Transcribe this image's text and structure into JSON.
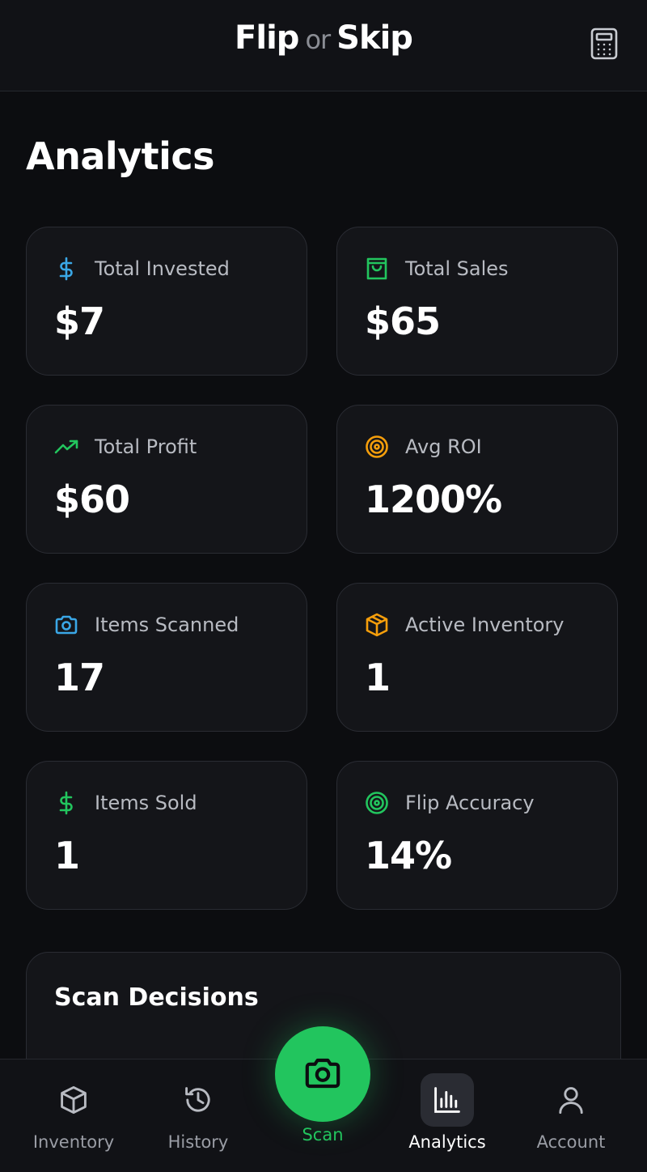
{
  "header": {
    "logo": {
      "word1": "Flip",
      "word2": "or",
      "word3": "Skip"
    },
    "calculator_icon": "calculator-icon"
  },
  "page": {
    "title": "Analytics"
  },
  "stats": [
    {
      "label": "Total Invested",
      "value": "$7",
      "icon": "dollar-icon",
      "color": "#3aa7e6"
    },
    {
      "label": "Total Sales",
      "value": "$65",
      "icon": "shopping-bag-icon",
      "color": "#22c55e"
    },
    {
      "label": "Total Profit",
      "value": "$60",
      "icon": "trending-up-icon",
      "color": "#22c55e"
    },
    {
      "label": "Avg ROI",
      "value": "1200%",
      "icon": "target-icon",
      "color": "#f59e0b"
    },
    {
      "label": "Items Scanned",
      "value": "17",
      "icon": "camera-icon",
      "color": "#3aa7e6"
    },
    {
      "label": "Active Inventory",
      "value": "1",
      "icon": "box-icon",
      "color": "#f59e0b"
    },
    {
      "label": "Items Sold",
      "value": "1",
      "icon": "dollar-icon",
      "color": "#22c55e"
    },
    {
      "label": "Flip Accuracy",
      "value": "14%",
      "icon": "target-icon",
      "color": "#22c55e"
    }
  ],
  "decisions": {
    "title": "Scan Decisions"
  },
  "nav": {
    "items": [
      {
        "label": "Inventory",
        "icon": "box-icon"
      },
      {
        "label": "History",
        "icon": "history-icon"
      },
      {
        "label": "Scan",
        "icon": "camera-icon"
      },
      {
        "label": "Analytics",
        "icon": "bar-chart-icon",
        "active": true
      },
      {
        "label": "Account",
        "icon": "user-icon"
      }
    ]
  },
  "colors": {
    "accent": "#22c55e",
    "background": "#0c0d10",
    "card": "#141519"
  }
}
